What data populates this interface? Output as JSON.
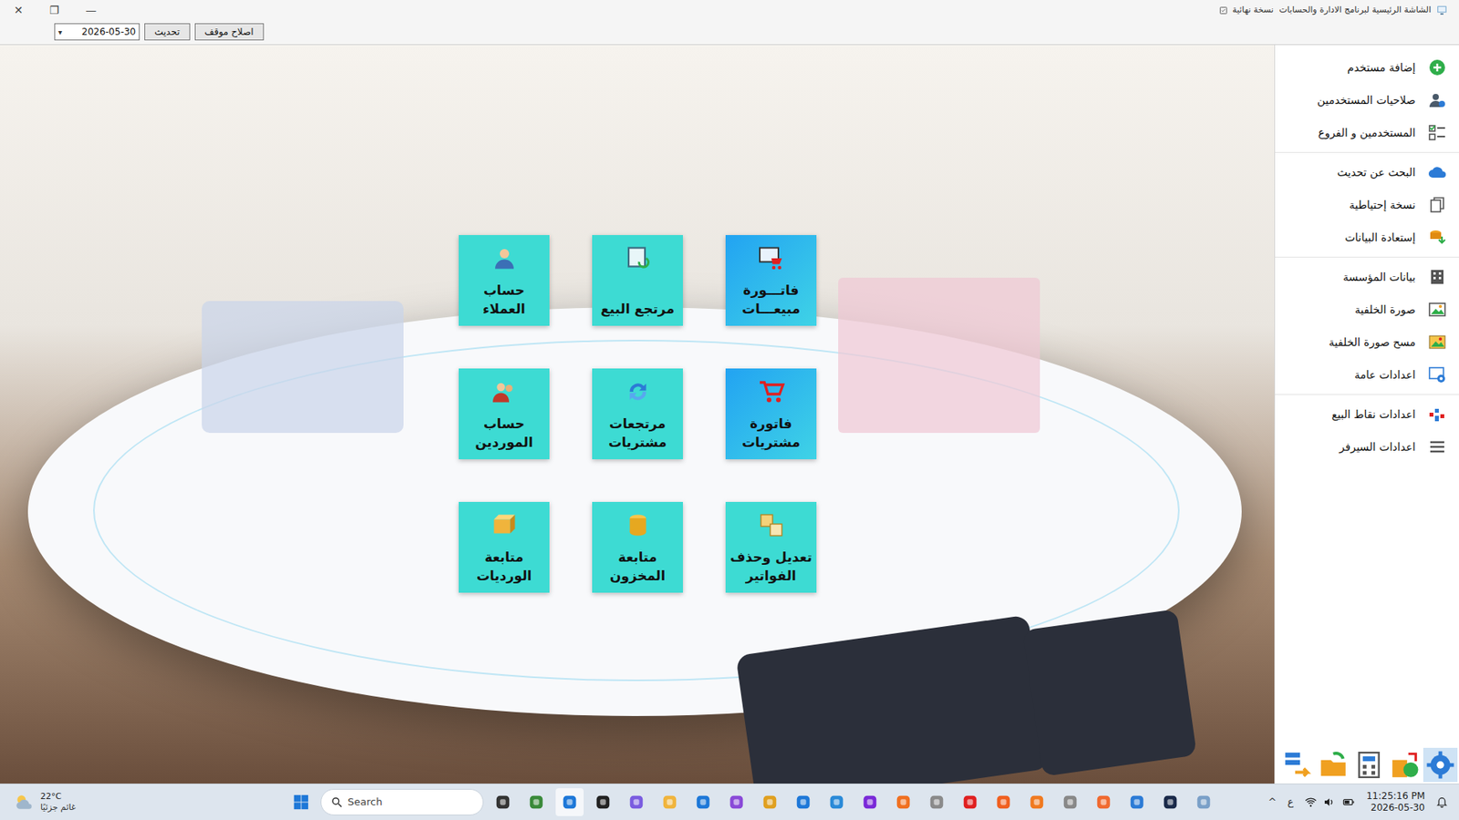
{
  "window": {
    "title": "الشاشة الرئيسية لبرنامج الادارة والحسابات  نسخة نهائية",
    "controls": [
      "✕",
      "❐",
      "—"
    ]
  },
  "toolbar": {
    "date": "2026-05-30",
    "dropdown_arrow": "▾",
    "buttons": [
      "تحديث",
      "اصلاح موقف"
    ]
  },
  "tiles": [
    {
      "label": "حساب\nالعملاء",
      "color": "#3ddbd3"
    },
    {
      "label": "مرتجع البيع",
      "color": "#3ddbd3"
    },
    {
      "label": "فاتـــورة\nمبيعـــات",
      "color": "#22a3f2"
    },
    {
      "label": "حساب\nالموردين",
      "color": "#3ddbd3"
    },
    {
      "label": "مرتجعات\nمشتريات",
      "color": "#3ddbd3"
    },
    {
      "label": "فاتورة\nمشتريات",
      "color": "#22a3f2"
    },
    {
      "label": "متابعة\nالورديات",
      "color": "#3ddbd3"
    },
    {
      "label": "متابعة\nالمخزون",
      "color": "#3ddbd3"
    },
    {
      "label": "تعديل وحذف\nالفواتير",
      "color": "#3ddbd3"
    }
  ],
  "sidebar": {
    "groups": [
      {
        "items": [
          {
            "label": "إضافة مستخدم"
          },
          {
            "label": "صلاحيات المستخدمين"
          },
          {
            "label": "المستخدمين و الفروع"
          }
        ]
      },
      {
        "items": [
          {
            "label": "البحث عن تحديث"
          },
          {
            "label": "نسخة إحتياطية"
          },
          {
            "label": "إستعادة البيانات"
          }
        ]
      },
      {
        "items": [
          {
            "label": "بيانات المؤسسة"
          },
          {
            "label": "صورة الخلفية"
          },
          {
            "label": "مسح صورة الخلفية"
          },
          {
            "label": "اعدادات عامة"
          }
        ]
      },
      {
        "items": [
          {
            "label": "اعدادات نقاط البيع"
          },
          {
            "label": "اعدادات السيرفر"
          }
        ]
      }
    ]
  },
  "taskbar": {
    "weather": {
      "temp": "22°C",
      "condition": "غائم جزئيًا"
    },
    "search": {
      "placeholder": "Search"
    },
    "tray_chevron": "^",
    "keyboard": "ع",
    "clock": {
      "time": "11:25:16 PM",
      "date": "2026-05-30"
    }
  }
}
